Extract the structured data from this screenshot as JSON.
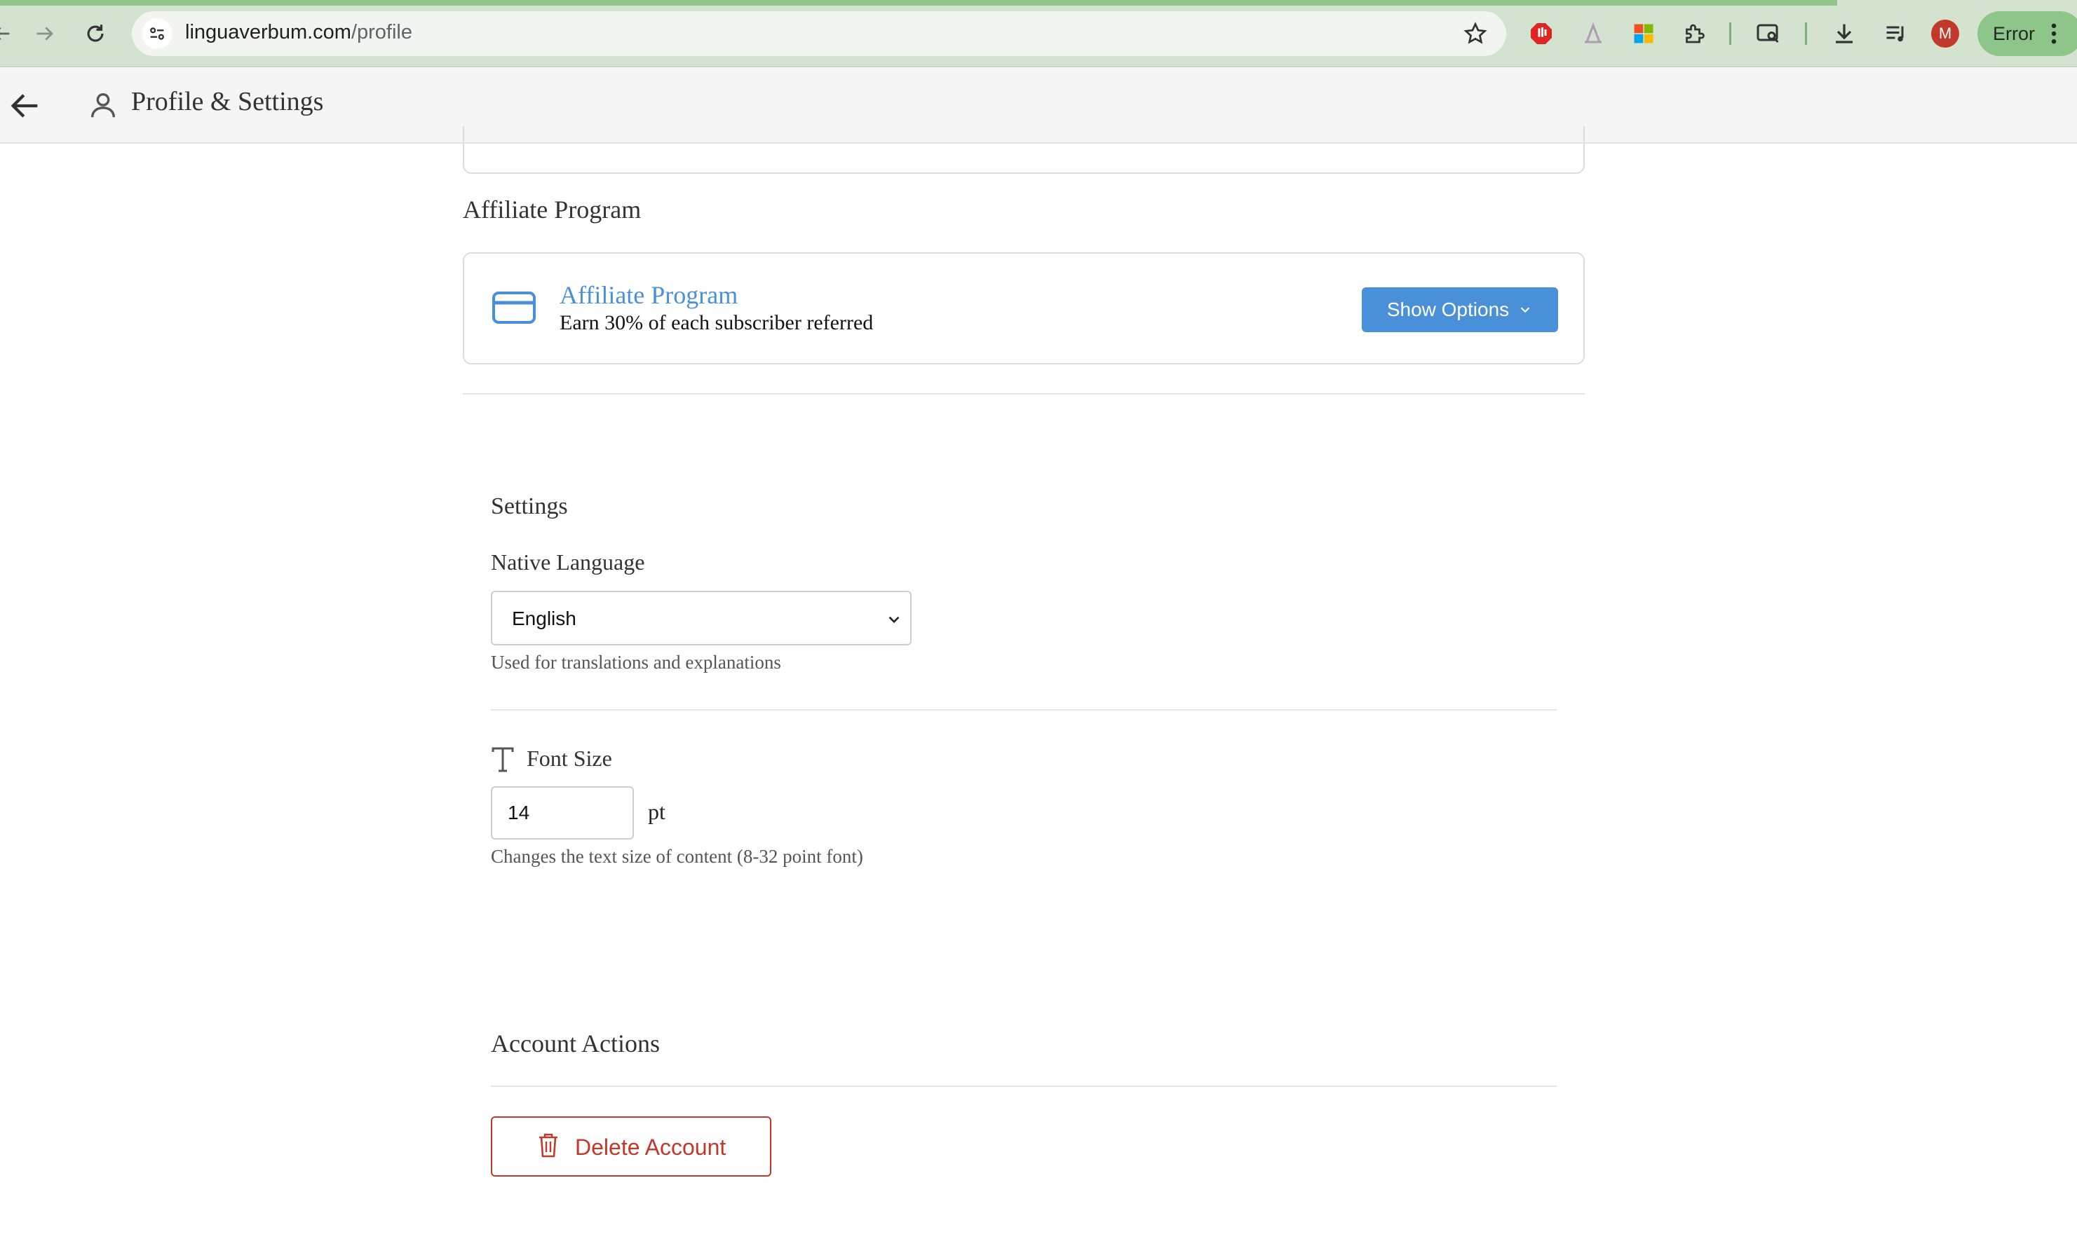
{
  "browser": {
    "url_host": "linguaverbum.com",
    "url_path": "/profile",
    "profile_initial": "M",
    "status_pill": "Error"
  },
  "header": {
    "title": "Profile & Settings"
  },
  "affiliate": {
    "section_title": "Affiliate Program",
    "card_title": "Affiliate Program",
    "card_subtitle": "Earn 30% of each subscriber referred",
    "button_label": "Show Options"
  },
  "settings": {
    "section_title": "Settings",
    "native_language": {
      "label": "Native Language",
      "value": "English",
      "help": "Used for translations and explanations"
    },
    "font_size": {
      "label": "Font Size",
      "value": "14",
      "unit": "pt",
      "help": "Changes the text size of content (8-32 point font)"
    }
  },
  "account_actions": {
    "section_title": "Account Actions",
    "delete_label": "Delete Account"
  },
  "colors": {
    "accent": "#4a90d9",
    "danger": "#c0392b",
    "chrome": "#d3e3d0"
  }
}
